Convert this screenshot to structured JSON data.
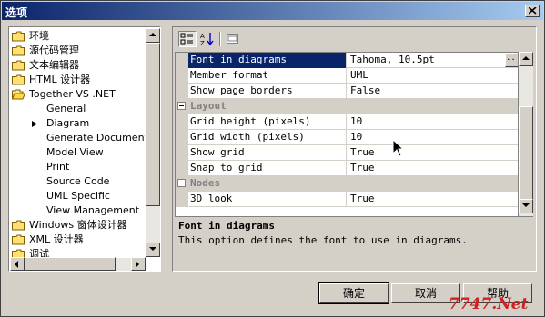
{
  "window": {
    "title": "选项"
  },
  "tree": {
    "items": [
      {
        "label": "环境",
        "icon": "folder-icon"
      },
      {
        "label": "源代码管理",
        "icon": "folder-icon"
      },
      {
        "label": "文本编辑器",
        "icon": "folder-icon"
      },
      {
        "label": "HTML 设计器",
        "icon": "folder-icon"
      },
      {
        "label": "Together VS .NET",
        "icon": "folder-open-icon"
      },
      {
        "label": "General"
      },
      {
        "label": "Diagram",
        "selected": true
      },
      {
        "label": "Generate Document"
      },
      {
        "label": "Model View"
      },
      {
        "label": "Print"
      },
      {
        "label": "Source Code"
      },
      {
        "label": "UML Specific"
      },
      {
        "label": "View Management"
      },
      {
        "label": "Windows 窗体设计器",
        "icon": "folder-icon"
      },
      {
        "label": "XML 设计器",
        "icon": "folder-icon"
      },
      {
        "label": "调试",
        "icon": "folder-icon"
      }
    ]
  },
  "toolbar": {
    "buttons": [
      "categorized-icon",
      "alphabetical-icon",
      "property-pages-icon"
    ]
  },
  "properties": {
    "rows": [
      {
        "name": "Font in diagrams",
        "value": "Tahoma, 10.5pt",
        "selected": true
      },
      {
        "name": "Member format",
        "value": "UML"
      },
      {
        "name": "Show page borders",
        "value": "False"
      },
      {
        "category": "Layout"
      },
      {
        "name": "Grid height (pixels)",
        "value": "10"
      },
      {
        "name": "Grid width (pixels)",
        "value": "10"
      },
      {
        "name": "Show grid",
        "value": "True"
      },
      {
        "name": "Snap to grid",
        "value": "True"
      },
      {
        "category": "Nodes"
      },
      {
        "name": "3D look",
        "value": "True"
      }
    ],
    "ellipsis_label": "..."
  },
  "description": {
    "title": "Font in diagrams",
    "text": "This option defines the font to use in diagrams."
  },
  "buttons": {
    "ok": "确定",
    "cancel": "取消",
    "help": "帮助"
  },
  "watermark": "7747.Net"
}
